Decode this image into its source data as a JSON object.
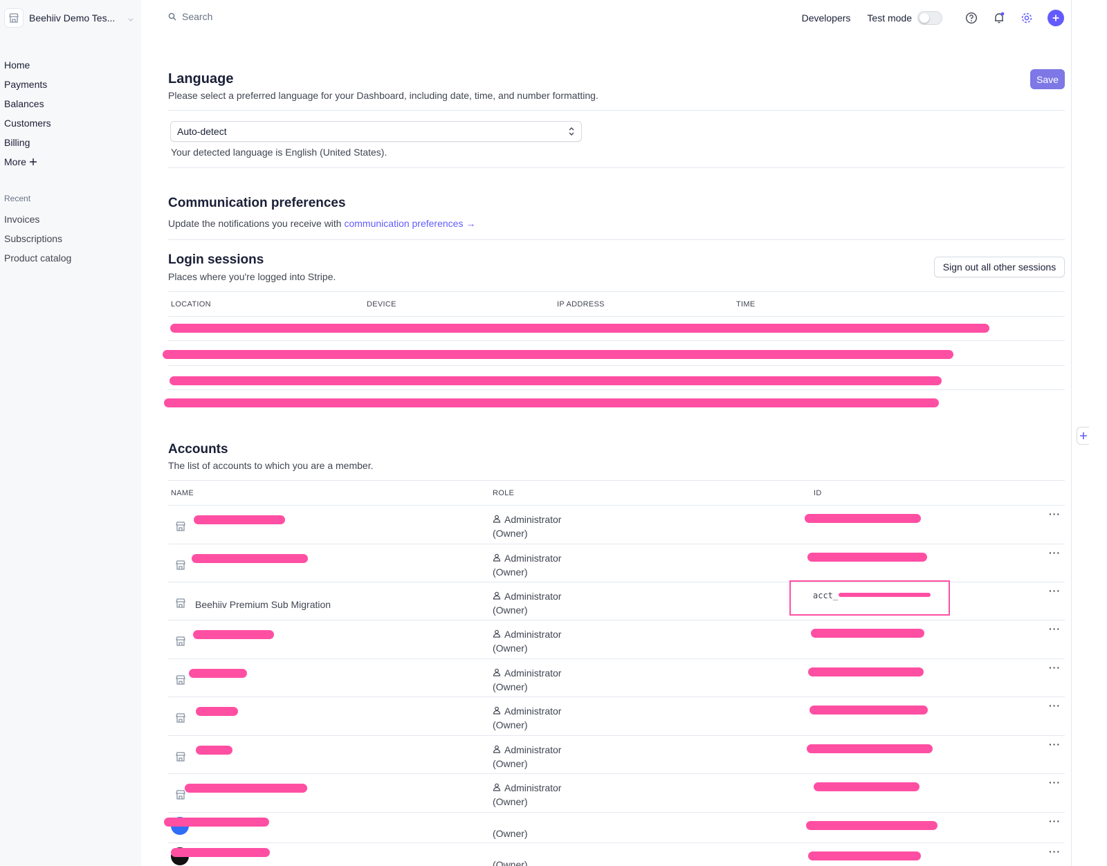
{
  "sidebar": {
    "account_name": "Beehiiv Demo Tes...",
    "nav": [
      {
        "label": "Home"
      },
      {
        "label": "Payments"
      },
      {
        "label": "Balances"
      },
      {
        "label": "Customers"
      },
      {
        "label": "Billing"
      },
      {
        "label": "More"
      }
    ],
    "recent_label": "Recent",
    "recent": [
      {
        "label": "Invoices"
      },
      {
        "label": "Subscriptions"
      },
      {
        "label": "Product catalog"
      }
    ]
  },
  "topbar": {
    "search_placeholder": "Search",
    "developers": "Developers",
    "test_mode": "Test mode",
    "test_mode_on": false
  },
  "language": {
    "title": "Language",
    "description": "Please select a preferred language for your Dashboard, including date, time, and number formatting.",
    "save_label": "Save",
    "selected": "Auto-detect",
    "detected": "Your detected language is English (United States)."
  },
  "communication": {
    "title": "Communication preferences",
    "text": "Update the notifications you receive with",
    "link": "communication preferences →"
  },
  "sessions": {
    "title": "Login sessions",
    "description": "Places where you're logged into Stripe.",
    "signout_label": "Sign out all other sessions",
    "columns": [
      "LOCATION",
      "DEVICE",
      "IP ADDRESS",
      "TIME"
    ]
  },
  "accounts": {
    "title": "Accounts",
    "description": "The list of accounts to which you are a member.",
    "columns": [
      "NAME",
      "ROLE",
      "ID"
    ],
    "rows": [
      {
        "name": "",
        "role": "Administrator",
        "owner": "(Owner)",
        "id": ""
      },
      {
        "name": "",
        "role": "Administrator",
        "owner": "(Owner)",
        "id": ""
      },
      {
        "name": "Beehiiv Premium Sub Migration",
        "role": "Administrator",
        "owner": "(Owner)",
        "id": "acct_"
      },
      {
        "name": "",
        "role": "Administrator",
        "owner": "(Owner)",
        "id": ""
      },
      {
        "name": "",
        "role": "Administrator",
        "owner": "(Owner)",
        "id": ""
      },
      {
        "name": "",
        "role": "Administrator",
        "owner": "(Owner)",
        "id": ""
      },
      {
        "name": "",
        "role": "Administrator",
        "owner": "(Owner)",
        "id": ""
      },
      {
        "name": "",
        "role": "Administrator",
        "owner": "(Owner)",
        "id": ""
      },
      {
        "name": "",
        "role": "",
        "owner": "(Owner)",
        "id": ""
      },
      {
        "name": "",
        "role": "",
        "owner": "(Owner)",
        "id": ""
      }
    ]
  },
  "colors": {
    "accent": "#635bff",
    "redaction": "#ff4fa3"
  }
}
